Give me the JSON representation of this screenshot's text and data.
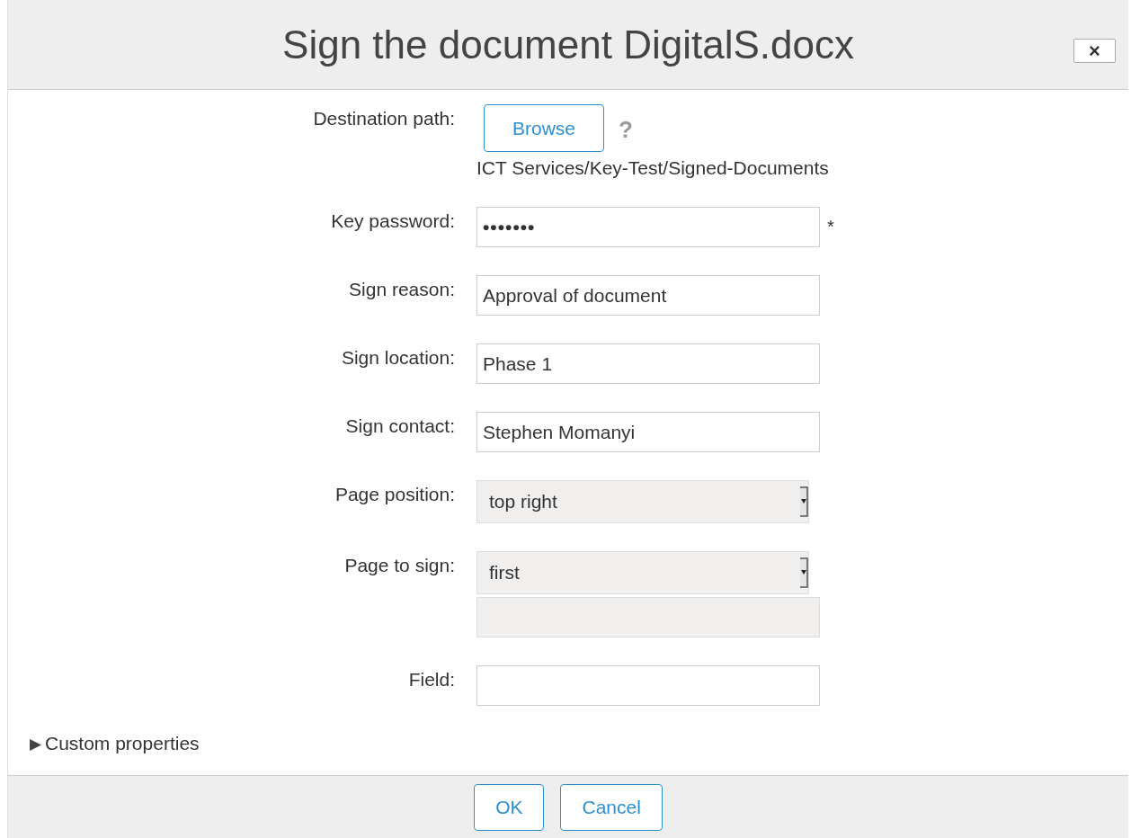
{
  "dialog": {
    "title": "Sign the document DigitalS.docx",
    "close": "×"
  },
  "fields": [
    {
      "kind": "browse",
      "label": "Destination path:",
      "button": "Browse",
      "help": "?",
      "path": "ICT Services/Key-Test/Signed-Documents"
    },
    {
      "kind": "password",
      "label": "Key password:",
      "value": "•••••••",
      "required": "*"
    },
    {
      "kind": "text",
      "label": "Sign reason:",
      "value": "Approval of document"
    },
    {
      "kind": "text",
      "label": "Sign location:",
      "value": "Phase 1"
    },
    {
      "kind": "text",
      "label": "Sign contact:",
      "value": "Stephen Momanyi"
    },
    {
      "kind": "select",
      "label": "Page position:",
      "value": "top right",
      "extra_field": false
    },
    {
      "kind": "select",
      "label": "Page to sign:",
      "value": "first",
      "extra_field": true
    },
    {
      "kind": "text",
      "label": "Field:"
    }
  ],
  "custom_properties": {
    "toggle": "▶",
    "label": "Custom properties",
    "expanded": false
  },
  "buttons": [
    "OK",
    "Cancel"
  ]
}
